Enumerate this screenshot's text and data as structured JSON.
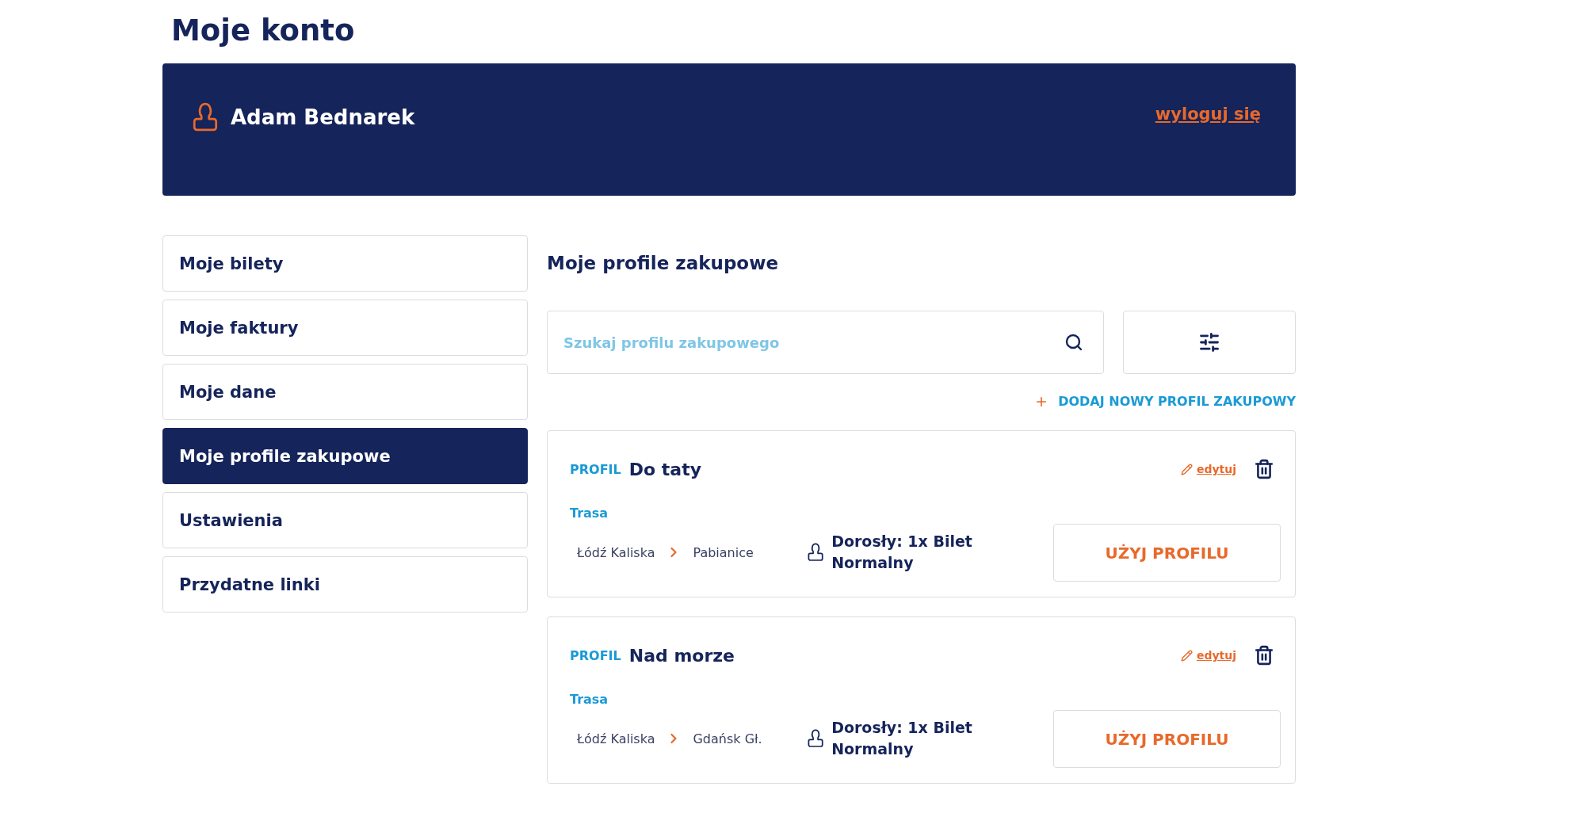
{
  "page": {
    "title": "Moje konto"
  },
  "account_banner": {
    "user_name": "Adam Bednarek",
    "logout_link": "wyloguj się"
  },
  "sidebar": {
    "items": [
      {
        "label": "Moje bilety",
        "selected": false
      },
      {
        "label": "Moje faktury",
        "selected": false
      },
      {
        "label": "Moje dane",
        "selected": false
      },
      {
        "label": "Moje profile zakupowe",
        "selected": true
      },
      {
        "label": "Ustawienia",
        "selected": false
      },
      {
        "label": "Przydatne linki",
        "selected": false
      }
    ]
  },
  "main": {
    "heading": "Moje profile zakupowe",
    "search": {
      "placeholder": "Szukaj profilu zakupowego"
    },
    "add_link": "DODAJ NOWY PROFIL ZAKUPOWY",
    "profiles": [
      {
        "tag": "PROFIL",
        "name": "Do taty",
        "edit_link": "edytuj",
        "route_label": "Trasa",
        "from": "Łódź Kaliska",
        "to": "Pabianice",
        "passengers": "Dorosły: 1x Bilet Normalny",
        "use_button": "UŻYJ PROFILU"
      },
      {
        "tag": "PROFIL",
        "name": "Nad morze",
        "edit_link": "edytuj",
        "route_label": "Trasa",
        "from": "Łódź Kaliska",
        "to": "Gdańsk Gł.",
        "passengers": "Dorosły: 1x Bilet Normalny",
        "use_button": "UŻYJ PROFILU"
      }
    ]
  }
}
